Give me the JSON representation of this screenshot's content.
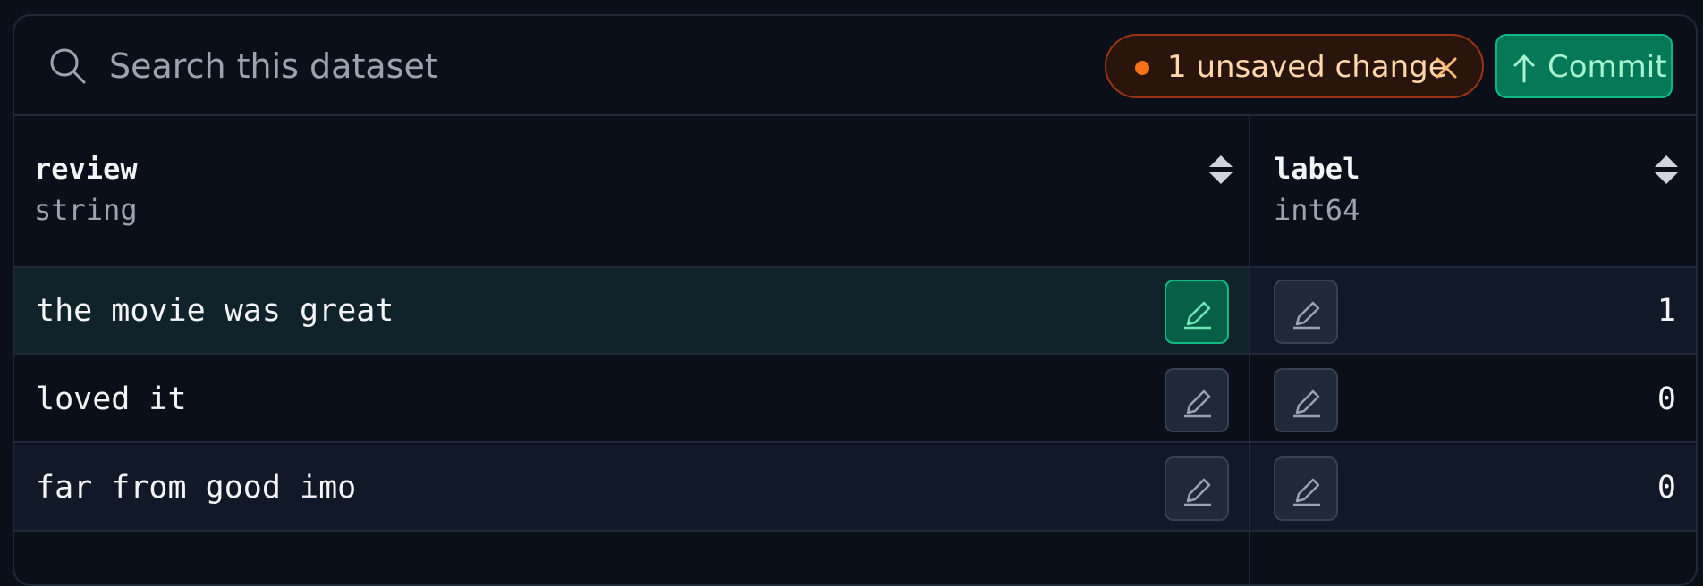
{
  "search": {
    "placeholder": "Search this dataset"
  },
  "status": {
    "unsaved_label": "1 unsaved change",
    "dot_color": "#f97316"
  },
  "toolbar": {
    "commit_label": "Commit",
    "commit_color": "#047857"
  },
  "columns": [
    {
      "name": "review",
      "type": "string"
    },
    {
      "name": "label",
      "type": "int64"
    }
  ],
  "rows": [
    {
      "review": "the movie was great",
      "label": "1",
      "edited": true
    },
    {
      "review": "loved it",
      "label": "0",
      "edited": false
    },
    {
      "review": "far from good imo",
      "label": "0",
      "edited": false
    }
  ]
}
